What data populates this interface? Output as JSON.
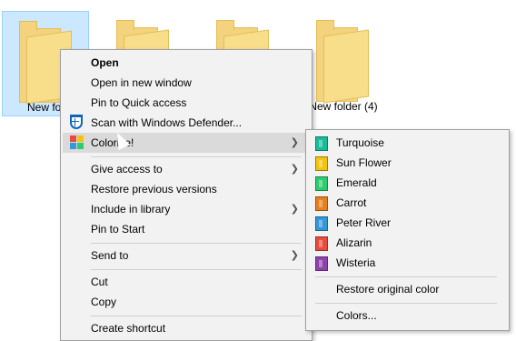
{
  "folders": [
    {
      "label": "New fol",
      "selected": true
    },
    {
      "label": "",
      "selected": false
    },
    {
      "label": "",
      "selected": false
    },
    {
      "label": "New folder (4)",
      "selected": false
    }
  ],
  "menu": {
    "items": [
      {
        "label": "Open"
      },
      {
        "label": "Open in new window"
      },
      {
        "label": "Pin to Quick access"
      },
      {
        "label": "Scan with Windows Defender..."
      },
      {
        "label": "Colorize!"
      },
      {
        "label": "Give access to"
      },
      {
        "label": "Restore previous versions"
      },
      {
        "label": "Include in library"
      },
      {
        "label": "Pin to Start"
      },
      {
        "label": "Send to"
      },
      {
        "label": "Cut"
      },
      {
        "label": "Copy"
      },
      {
        "label": "Create shortcut"
      }
    ]
  },
  "submenu": {
    "colors": [
      {
        "label": "Turquoise",
        "color": "#1abc9c"
      },
      {
        "label": "Sun Flower",
        "color": "#f1c40f"
      },
      {
        "label": "Emerald",
        "color": "#2ecc71"
      },
      {
        "label": "Carrot",
        "color": "#e67e22"
      },
      {
        "label": "Peter River",
        "color": "#3498db"
      },
      {
        "label": "Alizarin",
        "color": "#e74c3c"
      },
      {
        "label": "Wisteria",
        "color": "#8e44ad"
      }
    ],
    "restore_label": "Restore original color",
    "colors_label": "Colors..."
  }
}
